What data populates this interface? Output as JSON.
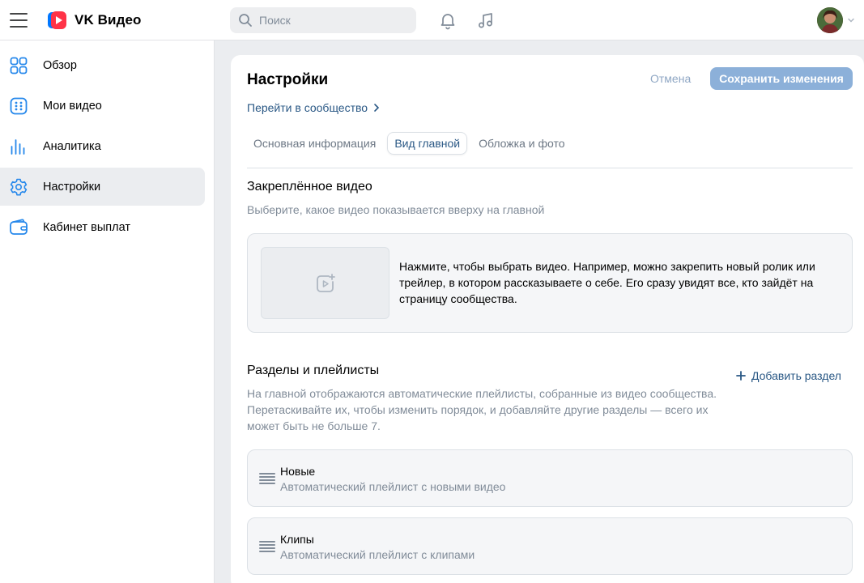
{
  "header": {
    "logo_text": "VK Видео",
    "search_placeholder": "Поиск",
    "icons": [
      "menu-icon",
      "vk-video-logo-icon",
      "search-icon",
      "bell-icon",
      "music-icon",
      "chevron-down-icon"
    ]
  },
  "sidebar": {
    "items": [
      {
        "label": "Обзор",
        "icon": "grid-icon"
      },
      {
        "label": "Мои видео",
        "icon": "dice-icon"
      },
      {
        "label": "Аналитика",
        "icon": "bar-chart-icon"
      },
      {
        "label": "Настройки",
        "icon": "gear-icon",
        "active": true
      },
      {
        "label": "Кабинет выплат",
        "icon": "wallet-icon"
      }
    ]
  },
  "main": {
    "title": "Настройки",
    "cancel_label": "Отмена",
    "save_label": "Сохранить изменения",
    "community_link": "Перейти в сообщество",
    "tabs": [
      {
        "label": "Основная информация"
      },
      {
        "label": "Вид главной",
        "active": true
      },
      {
        "label": "Обложка и фото"
      }
    ],
    "pinned": {
      "title": "Закреплённое видео",
      "description": "Выберите, какое видео показывается вверху на главной",
      "placeholder_text": "Нажмите, чтобы выбрать видео. Например, можно закрепить новый ролик или трейлер, в котором рассказываете о себе. Его сразу увидят все, кто зайдёт на страницу сообщества."
    },
    "sections": {
      "title": "Разделы и плейлисты",
      "description": "На главной отображаются автоматические плейлисты, собранные из видео сообщества. Перетаскивайте их, чтобы изменить порядок, и добавляйте другие разделы — всего их может быть не больше 7.",
      "add_label": "Добавить раздел",
      "playlists": [
        {
          "name": "Новые",
          "description": "Автоматический плейлист с новыми видео"
        },
        {
          "name": "Клипы",
          "description": "Автоматический плейлист с клипами"
        }
      ]
    }
  },
  "colors": {
    "accent": "#2a5885",
    "save_button": "#8cb0d9",
    "logo_red": "#ff3347",
    "background": "#ebedf0"
  }
}
